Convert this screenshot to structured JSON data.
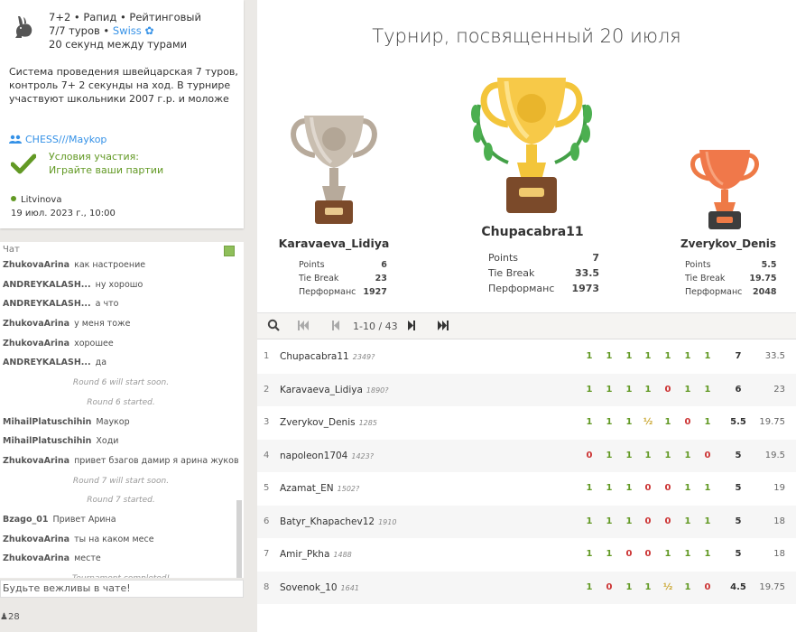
{
  "info": {
    "line1": "7+2 • Рапид • Рейтинговый",
    "line2_a": "7/7 туров • ",
    "line2_link": "Swiss",
    "line3": "20 секунд между турами",
    "description": "Система проведения швейцарская 7 туров, контроль 7+ 2 секунды на ход. В турнире участвуют школьники 2007 г.р. и моложе",
    "team": "CHESS///Maykop",
    "conditions_line1": "Условия участия:",
    "conditions_line2": "Играйте ваши партии",
    "creator": "Litvinova",
    "created": "19 июл. 2023 г., 10:00"
  },
  "chat": {
    "title": "Чат",
    "input_placeholder": "Будьте вежливы в чате!",
    "watchers": "28",
    "messages": [
      {
        "user": "ZhukovaArina",
        "text": "как настроение"
      },
      {
        "user": "ANDREYKALASH...",
        "text": "ну хорошо"
      },
      {
        "user": "ANDREYKALASH...",
        "text": "а что"
      },
      {
        "user": "ZhukovaArina",
        "text": "у меня тоже"
      },
      {
        "user": "ZhukovaArina",
        "text": "хорошее"
      },
      {
        "user": "ANDREYKALASH...",
        "text": "да"
      },
      {
        "user": "",
        "text": "Round 6 will start soon."
      },
      {
        "user": "",
        "text": "Round 6 started."
      },
      {
        "user": "MihailPlatuschihin",
        "text": "Маукор"
      },
      {
        "user": "MihailPlatuschihin",
        "text": "Ходи"
      },
      {
        "user": "ZhukovaArina",
        "text": "привет бзагов дамир я арина жукова"
      },
      {
        "user": "",
        "text": "Round 7 will start soon."
      },
      {
        "user": "",
        "text": "Round 7 started."
      },
      {
        "user": "Bzago_01",
        "text": "Привет Арина"
      },
      {
        "user": "ZhukovaArina",
        "text": "ты на каком месе"
      },
      {
        "user": "ZhukovaArina",
        "text": "месте"
      },
      {
        "user": "",
        "text": "Tournament completed!"
      }
    ]
  },
  "main": {
    "title": "Турнир, посвященный 20 июля",
    "labels": {
      "points": "Points",
      "tiebreak": "Tie Break",
      "performance": "Перформанс"
    },
    "podium": [
      {
        "place": 2,
        "name": "Karavaeva_Lidiya",
        "points": "6",
        "tiebreak": "23",
        "performance": "1927",
        "color": "#b7aa9b"
      },
      {
        "place": 1,
        "name": "Chupacabra11",
        "points": "7",
        "tiebreak": "33.5",
        "performance": "1973",
        "color": "#f3c53a"
      },
      {
        "place": 3,
        "name": "Zverykov_Denis",
        "points": "5.5",
        "tiebreak": "19.75",
        "performance": "2048",
        "color": "#ee7a46"
      }
    ],
    "pager": {
      "range": "1-10 / 43"
    },
    "standings": [
      {
        "rank": "1",
        "name": "Chupacabra11",
        "rating": "2349?",
        "scores": [
          "1",
          "1",
          "1",
          "1",
          "1",
          "1",
          "1"
        ],
        "points": "7",
        "tiebreak": "33.5"
      },
      {
        "rank": "2",
        "name": "Karavaeva_Lidiya",
        "rating": "1890?",
        "scores": [
          "1",
          "1",
          "1",
          "1",
          "0",
          "1",
          "1"
        ],
        "points": "6",
        "tiebreak": "23"
      },
      {
        "rank": "3",
        "name": "Zverykov_Denis",
        "rating": "1285",
        "scores": [
          "1",
          "1",
          "1",
          "½",
          "1",
          "0",
          "1"
        ],
        "points": "5.5",
        "tiebreak": "19.75"
      },
      {
        "rank": "4",
        "name": "napoleon1704",
        "rating": "1423?",
        "scores": [
          "0",
          "1",
          "1",
          "1",
          "1",
          "1",
          "0"
        ],
        "points": "5",
        "tiebreak": "19.5"
      },
      {
        "rank": "5",
        "name": "Azamat_EN",
        "rating": "1502?",
        "scores": [
          "1",
          "1",
          "1",
          "0",
          "0",
          "1",
          "1"
        ],
        "points": "5",
        "tiebreak": "19"
      },
      {
        "rank": "6",
        "name": "Batyr_Khapachev12",
        "rating": "1910",
        "scores": [
          "1",
          "1",
          "1",
          "0",
          "0",
          "1",
          "1"
        ],
        "points": "5",
        "tiebreak": "18"
      },
      {
        "rank": "7",
        "name": "Amir_Pkha",
        "rating": "1488",
        "scores": [
          "1",
          "1",
          "0",
          "0",
          "1",
          "1",
          "1"
        ],
        "points": "5",
        "tiebreak": "18"
      },
      {
        "rank": "8",
        "name": "Sovenok_10",
        "rating": "1641",
        "scores": [
          "1",
          "0",
          "1",
          "1",
          "½",
          "1",
          "0"
        ],
        "points": "4.5",
        "tiebreak": "19.75"
      }
    ]
  },
  "colors": {
    "win": "#629924",
    "loss": "#cc3333",
    "draw": "#c9a42a",
    "link": "#3692e7"
  },
  "icons": [
    "rabbit-icon",
    "gear-icon",
    "team-icon",
    "checkmark-icon",
    "online-dot-icon",
    "search-icon",
    "first-page-icon",
    "prev-page-icon",
    "next-page-icon",
    "last-page-icon",
    "trophy-icon",
    "watchers-icon"
  ]
}
